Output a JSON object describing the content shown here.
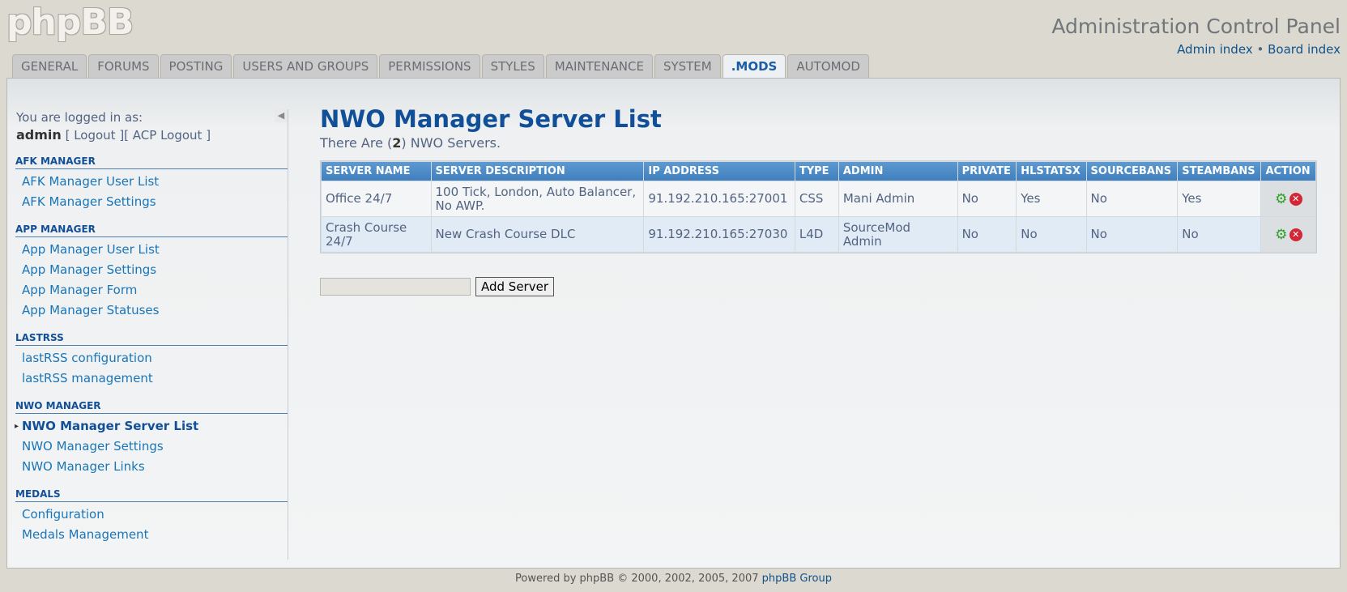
{
  "logo": {
    "text": "phpBB"
  },
  "header": {
    "title": "Administration Control Panel",
    "links": {
      "admin_index": "Admin index",
      "separator": "•",
      "board_index": "Board index"
    }
  },
  "tabs": [
    {
      "label": "GENERAL"
    },
    {
      "label": "FORUMS"
    },
    {
      "label": "POSTING"
    },
    {
      "label": "USERS AND GROUPS"
    },
    {
      "label": "PERMISSIONS"
    },
    {
      "label": "STYLES"
    },
    {
      "label": "MAINTENANCE"
    },
    {
      "label": "SYSTEM"
    },
    {
      "label": ".MODS",
      "active": true
    },
    {
      "label": "AUTOMOD"
    }
  ],
  "sidebar": {
    "logged_in_label": "You are logged in as:",
    "username": "admin",
    "logout": "Logout",
    "acp_logout": "ACP Logout",
    "sections": [
      {
        "title": "AFK MANAGER",
        "items": [
          "AFK Manager User List",
          "AFK Manager Settings"
        ]
      },
      {
        "title": "APP MANAGER",
        "items": [
          "App Manager User List",
          "App Manager Settings",
          "App Manager Form",
          "App Manager Statuses"
        ]
      },
      {
        "title": "LASTRSS",
        "items": [
          "lastRSS configuration",
          "lastRSS management"
        ]
      },
      {
        "title": "NWO MANAGER",
        "items": [
          "NWO Manager Server List",
          "NWO Manager Settings",
          "NWO Manager Links"
        ],
        "active_item": 0
      },
      {
        "title": "MEDALS",
        "items": [
          "Configuration",
          "Medals Management"
        ]
      }
    ]
  },
  "main": {
    "title": "NWO Manager Server List",
    "subtitle_prefix": "There Are (",
    "server_count": "2",
    "subtitle_suffix": ") NWO Servers.",
    "columns": [
      "SERVER NAME",
      "SERVER DESCRIPTION",
      "IP ADDRESS",
      "TYPE",
      "ADMIN",
      "PRIVATE",
      "HLSTATSX",
      "SOURCEBANS",
      "STEAMBANS",
      "ACTION"
    ],
    "rows": [
      [
        "Office 24/7",
        "100 Tick, London, Auto Balancer, No AWP.",
        "91.192.210.165:27001",
        "CSS",
        "Mani Admin",
        "No",
        "Yes",
        "No",
        "Yes"
      ],
      [
        "Crash Course 24/7",
        "New Crash Course DLC",
        "91.192.210.165:27030",
        "L4D",
        "SourceMod Admin",
        "No",
        "No",
        "No",
        "No"
      ]
    ],
    "add_button": "Add Server",
    "add_input_value": ""
  },
  "icons": {
    "edit": "gear-icon",
    "delete": "delete-icon",
    "collapse": "collapse-arrow-icon"
  },
  "footer": {
    "text": "Powered by phpBB © 2000, 2002, 2005, 2007",
    "link": "phpBB Group"
  }
}
